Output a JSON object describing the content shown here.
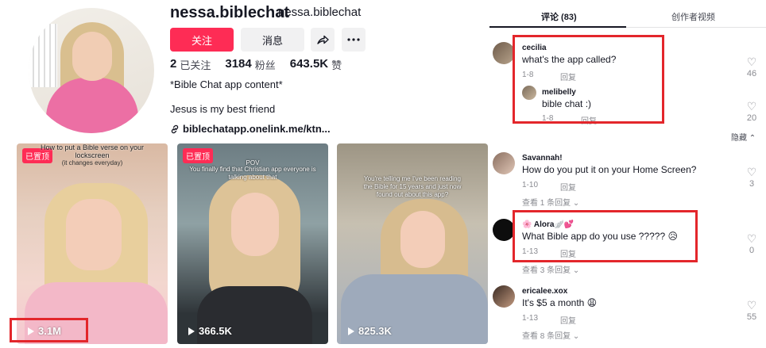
{
  "profile": {
    "username": "nessa.biblechat",
    "nickname": "nessa.biblechat",
    "follow_label": "关注",
    "message_label": "消息",
    "stats": [
      {
        "value": "2",
        "label": "已关注"
      },
      {
        "value": "3184",
        "label": "粉丝"
      },
      {
        "value": "643.5K",
        "label": "赞"
      }
    ],
    "bio_line1": "*Bible Chat app content*",
    "bio_line2": "Jesus is my best friend",
    "link": "biblechatapp.onelink.me/ktn..."
  },
  "videos": [
    {
      "pinned": "已置顶",
      "caption": "How to put a Bible verse on your lockscreen",
      "caption_sub": "(it changes everyday)",
      "views": "3.1M"
    },
    {
      "pinned": "已置顶",
      "caption": "POV",
      "caption_sub": "You finally find that Christian app everyone is talking about that",
      "views": "366.5K"
    },
    {
      "pinned": "",
      "caption": "You're telling me I've been reading the Bible for 15 years and just now found out about this app?",
      "caption_sub": "",
      "views": "825.3K"
    }
  ],
  "comments_panel": {
    "tab_comments": "评论 (83)",
    "tab_creator": "创作者视频",
    "hide_label": "隐藏",
    "reply_label": "回复",
    "comments": [
      {
        "name": "cecilia",
        "text": "what's the app called?",
        "date": "1-8",
        "likes": "46"
      },
      {
        "name": "melibelly",
        "text": "bible chat :)",
        "date": "1-8",
        "likes": "20"
      },
      {
        "name": "Savannah!",
        "text": "How do you put it on your Home Screen?",
        "date": "1-10",
        "likes": "3",
        "more": "查看 1 条回复"
      },
      {
        "name": "🌸 Alora🪽💕",
        "text": "What Bible app do you use ????? 😥",
        "date": "1-13",
        "likes": "0",
        "more": "查看 3 条回复"
      },
      {
        "name": "ericalee.xox",
        "text": "It's $5 a month 😩",
        "date": "1-13",
        "likes": "55",
        "more": "查看 8 条回复"
      }
    ]
  },
  "colors": {
    "accent": "#fe2c55",
    "highlight": "#e3262b"
  }
}
